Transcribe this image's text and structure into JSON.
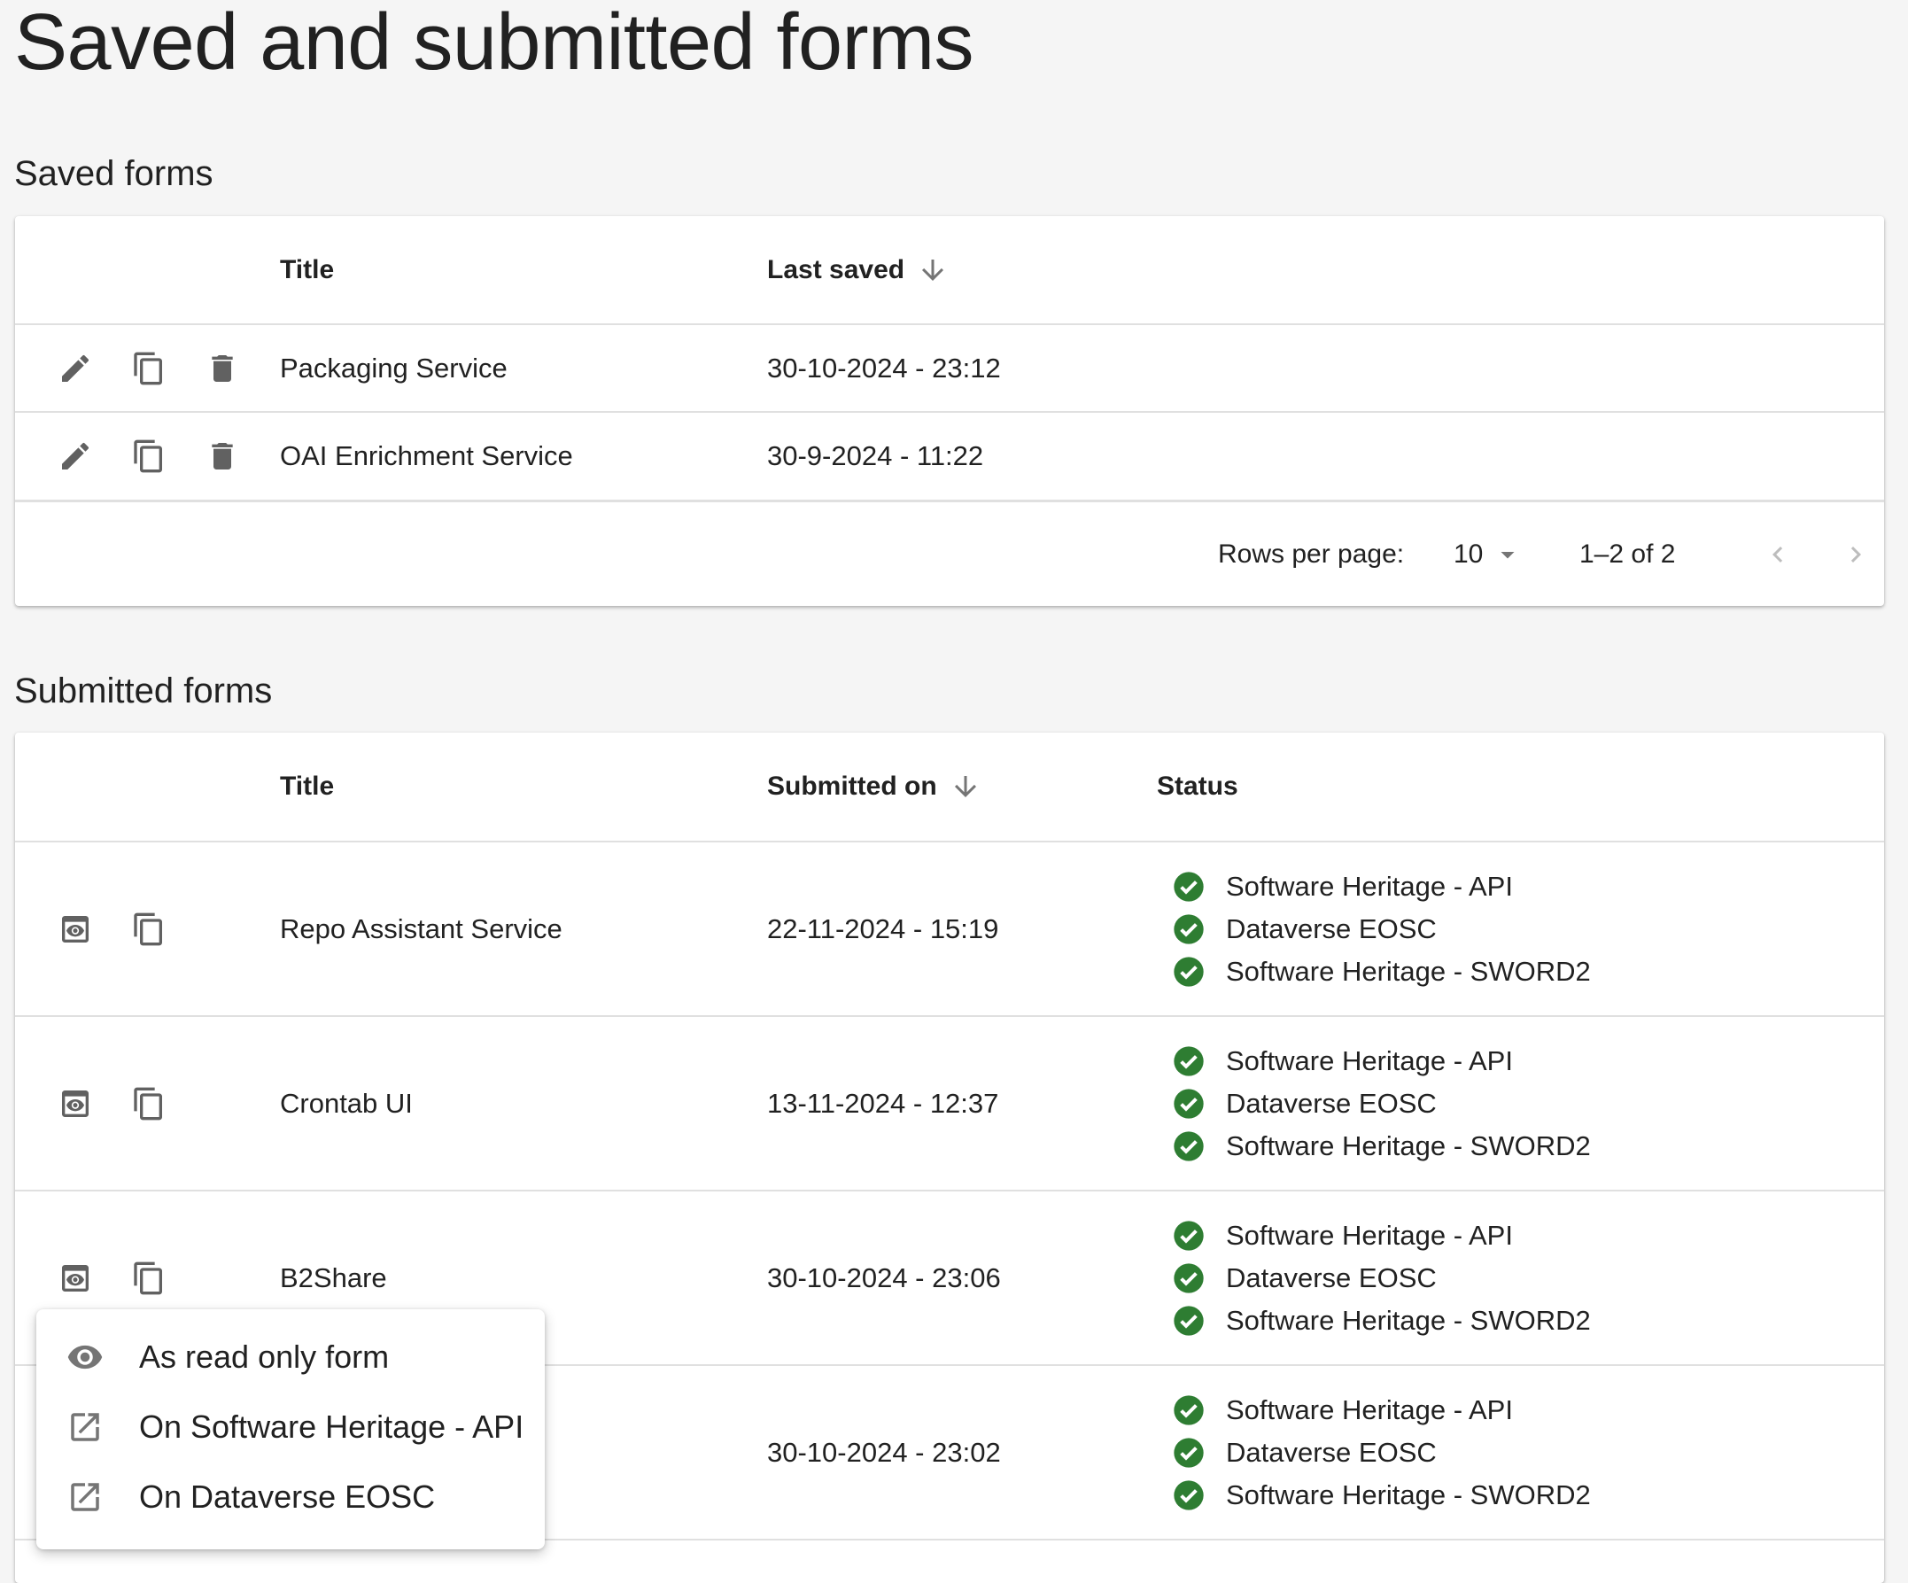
{
  "page": {
    "title": "Saved and submitted forms"
  },
  "saved": {
    "heading": "Saved forms",
    "columns": {
      "title": "Title",
      "last_saved": "Last saved"
    },
    "rows": [
      {
        "title": "Packaging Service",
        "date": "30-10-2024 - 23:12"
      },
      {
        "title": "OAI Enrichment Service",
        "date": "30-9-2024 - 11:22"
      }
    ],
    "pagination": {
      "rows_label": "Rows per page:",
      "rows_value": "10",
      "range": "1–2 of 2"
    }
  },
  "submitted": {
    "heading": "Submitted forms",
    "columns": {
      "title": "Title",
      "submitted_on": "Submitted on",
      "status": "Status"
    },
    "rows": [
      {
        "title": "Repo Assistant Service",
        "date": "22-11-2024 - 15:19",
        "statuses": [
          "Software Heritage - API",
          "Dataverse EOSC",
          "Software Heritage - SWORD2"
        ]
      },
      {
        "title": "Crontab UI",
        "date": "13-11-2024 - 12:37",
        "statuses": [
          "Software Heritage - API",
          "Dataverse EOSC",
          "Software Heritage - SWORD2"
        ]
      },
      {
        "title": "B2Share",
        "date": "30-10-2024 - 23:06",
        "statuses": [
          "Software Heritage - API",
          "Dataverse EOSC",
          "Software Heritage - SWORD2"
        ]
      },
      {
        "title": "",
        "date": "30-10-2024 - 23:02",
        "statuses": [
          "Software Heritage - API",
          "Dataverse EOSC",
          "Software Heritage - SWORD2"
        ]
      }
    ]
  },
  "menu": {
    "items": [
      {
        "label": "As read only form",
        "icon": "eye-icon"
      },
      {
        "label": "On Software Heritage - API",
        "icon": "open-in-new-icon"
      },
      {
        "label": "On Dataverse EOSC",
        "icon": "open-in-new-icon"
      }
    ]
  },
  "colors": {
    "success": "#2e7d32",
    "icon": "#616161",
    "background": "#f5f5f5"
  }
}
